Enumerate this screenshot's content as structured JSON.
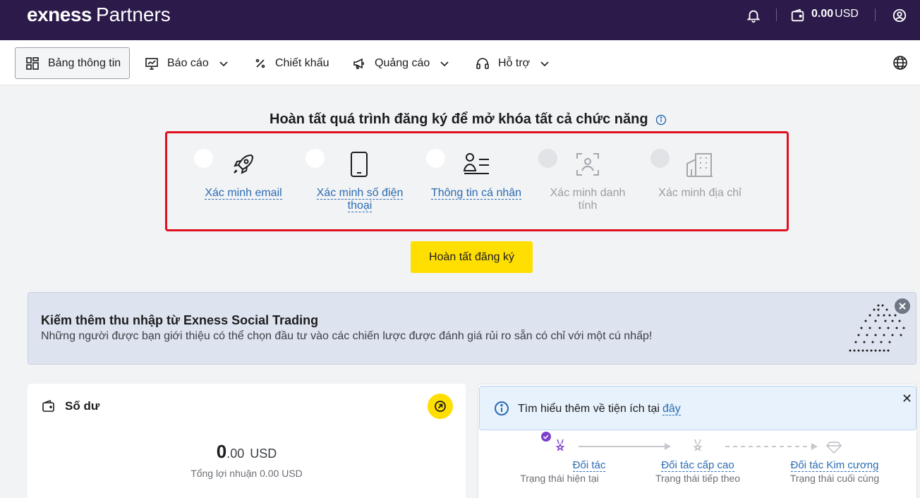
{
  "header": {
    "logo_brand": "exness",
    "logo_sub": "Partners",
    "balance_amount": "0.00",
    "balance_currency": "USD",
    "icons": [
      "bell-icon",
      "wallet-icon",
      "user-icon"
    ]
  },
  "nav": {
    "items": [
      {
        "label": "Bảng thông tin",
        "icon": "dashboard-icon"
      },
      {
        "label": "Báo cáo",
        "icon": "chart-icon"
      },
      {
        "label": "Chiết khấu",
        "icon": "percent-icon"
      },
      {
        "label": "Quảng cáo",
        "icon": "megaphone-icon"
      },
      {
        "label": "Hỗ trợ",
        "icon": "headset-icon"
      }
    ]
  },
  "registration": {
    "title": "Hoàn tất quá trình đăng ký để mở khóa tất cả chức năng",
    "steps": [
      {
        "label": "Xác minh email",
        "icon": "rocket-icon",
        "state": "active"
      },
      {
        "label_line1": "Xác minh số điện",
        "label_line2": "thoại",
        "icon": "phone-icon",
        "state": "active"
      },
      {
        "label": "Thông tin cá nhân",
        "icon": "profile-icon",
        "state": "active"
      },
      {
        "label_line1": "Xác minh danh",
        "label_line2": "tính",
        "icon": "face-scan-icon",
        "state": "locked"
      },
      {
        "label": "Xác minh địa chỉ",
        "icon": "building-icon",
        "state": "locked"
      }
    ],
    "button": "Hoàn tất đăng ký"
  },
  "banner": {
    "title": "Kiếm thêm thu nhập từ Exness Social Trading",
    "text": "Những người được bạn giới thiệu có thể chọn đầu tư vào các chiến lược được đánh giá rủi ro sẵn có chỉ với một cú nhấp!"
  },
  "balance_card": {
    "title": "Số dư",
    "amount_int": "0",
    "amount_dec": ".00",
    "currency": "USD",
    "profit": "Tổng lợi nhuận 0.00 USD"
  },
  "partner_card": {
    "info_text": "Tìm hiểu thêm về tiện ích tại",
    "info_link": "đây",
    "tiers": [
      {
        "name": "Đối tác",
        "state": "Trạng thái hiện tại"
      },
      {
        "name": "Đối tác cấp cao",
        "state": "Trạng thái tiếp theo"
      },
      {
        "name": "Đối tác Kim cương",
        "state": "Trạng thái cuối cùng"
      }
    ]
  },
  "colors": {
    "header_bg": "#2b1a4a",
    "accent_yellow": "#ffde02",
    "link_blue": "#2a6cb3",
    "highlight_red": "#e0101e"
  }
}
